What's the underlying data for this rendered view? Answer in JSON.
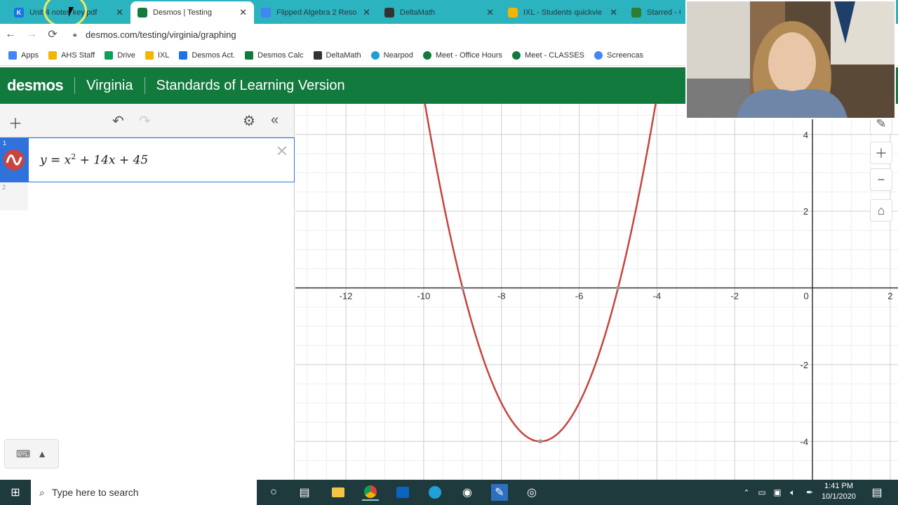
{
  "browser": {
    "tabs": [
      {
        "title": "Unit 4 notes key.pdf",
        "fav_letter": "K",
        "fav_color": "#1a73e8"
      },
      {
        "title": "Desmos | Testing",
        "fav_letter": "",
        "fav_color": "#127a3c"
      },
      {
        "title": "Flipped Algebra 2 Reso",
        "fav_letter": "",
        "fav_color": "#4285f4"
      },
      {
        "title": "DeltaMath",
        "fav_letter": "",
        "fav_color": "#333333"
      },
      {
        "title": "IXL - Students quickvie",
        "fav_letter": "",
        "fav_color": "#f4b400"
      },
      {
        "title": "Starred - C",
        "fav_letter": "",
        "fav_color": "#2e7d32"
      }
    ],
    "url": "desmos.com/testing/virginia/graphing",
    "bookmarks": [
      {
        "label": "Apps",
        "color": "#4285f4"
      },
      {
        "label": "AHS Staff",
        "color": "#f4b400"
      },
      {
        "label": "Drive",
        "color": "#0f9d58"
      },
      {
        "label": "IXL",
        "color": "#f4b400"
      },
      {
        "label": "Desmos Act.",
        "color": "#1a73e8"
      },
      {
        "label": "Desmos Calc",
        "color": "#127a3c"
      },
      {
        "label": "DeltaMath",
        "color": "#333333"
      },
      {
        "label": "Nearpod",
        "color": "#1a9fd8"
      },
      {
        "label": "Meet - Office Hours",
        "color": "#127a3c"
      },
      {
        "label": "Meet - CLASSES",
        "color": "#127a3c"
      },
      {
        "label": "Screencas",
        "color": "#4285f4"
      }
    ]
  },
  "desmos": {
    "logo": "desmos",
    "region": "Virginia",
    "version": "Standards of Learning Version",
    "expressions": [
      {
        "index": "1",
        "lhs": "y = x",
        "exp": "2",
        "rhs": " + 14x + 45"
      },
      {
        "index": "2"
      }
    ]
  },
  "graph_ticks": {
    "x": [
      "-12",
      "-10",
      "-8",
      "-6",
      "-4",
      "-2",
      "0",
      "2"
    ],
    "y": [
      "4",
      "2",
      "-2",
      "-4"
    ]
  },
  "chart_data": {
    "type": "line",
    "equation": "y = x^2 + 14x + 45",
    "xlim": [
      -13.3,
      2.2
    ],
    "ylim": [
      -5.0,
      4.8
    ],
    "curve_color": "#c74440",
    "points": [
      {
        "label": "vertex",
        "x": -7,
        "y": -4
      },
      {
        "label": "root",
        "x": -9,
        "y": 0
      },
      {
        "label": "root",
        "x": -5,
        "y": 0
      }
    ]
  },
  "taskbar": {
    "search_placeholder": "Type here to search",
    "time": "1:41 PM",
    "date": "10/1/2020"
  }
}
